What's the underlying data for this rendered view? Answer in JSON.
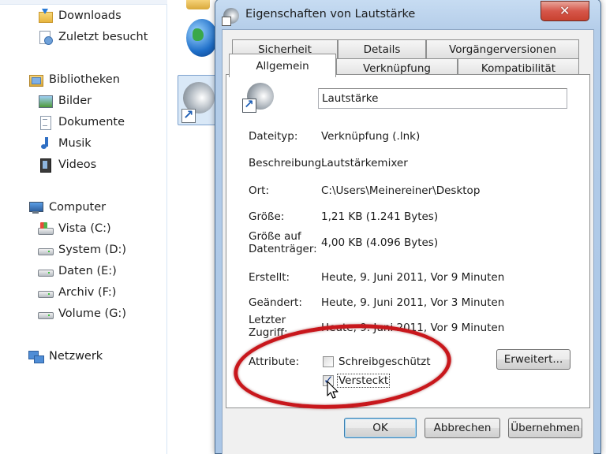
{
  "navigation": {
    "favorites": [
      {
        "label": "Downloads",
        "icon": "downloads-folder-icon"
      },
      {
        "label": "Zuletzt besucht",
        "icon": "recent-places-icon"
      }
    ],
    "libraries": {
      "label": "Bibliotheken",
      "icon": "libraries-icon"
    },
    "library_items": [
      {
        "label": "Bilder",
        "icon": "pictures-icon"
      },
      {
        "label": "Dokumente",
        "icon": "documents-icon"
      },
      {
        "label": "Musik",
        "icon": "music-icon"
      },
      {
        "label": "Videos",
        "icon": "videos-icon"
      }
    ],
    "computer": {
      "label": "Computer",
      "icon": "computer-icon"
    },
    "drives": [
      {
        "label": "Vista (C:)",
        "icon": "windows-drive-icon"
      },
      {
        "label": "System (D:)",
        "icon": "drive-icon"
      },
      {
        "label": "Daten (E:)",
        "icon": "drive-icon"
      },
      {
        "label": "Archiv (F:)",
        "icon": "drive-icon"
      },
      {
        "label": "Volume (G:)",
        "icon": "drive-icon"
      }
    ],
    "network": {
      "label": "Netzwerk",
      "icon": "network-icon"
    }
  },
  "dialog": {
    "title": "Eigenschaften von Lautstärke",
    "close_symbol": "✕",
    "tabs_back": [
      "Sicherheit",
      "Details",
      "Vorgängerversionen"
    ],
    "tabs_front": [
      "Allgemein",
      "Verknüpfung",
      "Kompatibilität"
    ],
    "active_tab": "Allgemein",
    "file_name": "Lautstärke",
    "properties": {
      "dateityp": {
        "label": "Dateityp:",
        "value": "Verknüpfung (.lnk)"
      },
      "beschreibung": {
        "label": "Beschreibung:",
        "value": "Lautstärkemixer"
      },
      "ort": {
        "label": "Ort:",
        "value": "C:\\Users\\Meinereiner\\Desktop"
      },
      "groesse": {
        "label": "Größe:",
        "value": "1,21 KB (1.241 Bytes)"
      },
      "groesse_datentraeger": {
        "label": "Größe auf Datenträger:",
        "value": "4,00 KB (4.096 Bytes)"
      },
      "erstellt": {
        "label": "Erstellt:",
        "value": "Heute, 9. Juni 2011, Vor 9 Minuten"
      },
      "geaendert": {
        "label": "Geändert:",
        "value": "Heute, 9. Juni 2011, Vor 3 Minuten"
      },
      "letzter_zugriff": {
        "label": "Letzter Zugriff:",
        "value": "Heute, 9. Juni 2011, Vor 9 Minuten"
      }
    },
    "attributes": {
      "label": "Attribute:",
      "read_only": {
        "label": "Schreibgeschützt",
        "checked": false
      },
      "hidden": {
        "label": "Versteckt",
        "checked": true
      },
      "advanced_button": "Erweitert..."
    },
    "buttons": {
      "ok": "OK",
      "cancel": "Abbrechen",
      "apply": "Übernehmen"
    }
  },
  "colors": {
    "annotation_ellipse": "#c8171c",
    "title_bar": "#b4cde9",
    "close_button": "#c8412f"
  }
}
